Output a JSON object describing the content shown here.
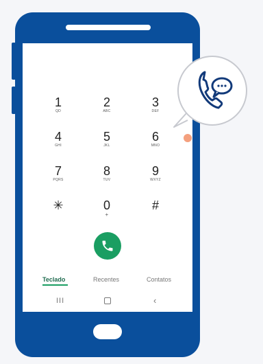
{
  "keypad": [
    {
      "num": "1",
      "sub": "QD"
    },
    {
      "num": "2",
      "sub": "ABC"
    },
    {
      "num": "3",
      "sub": "DEF"
    },
    {
      "num": "4",
      "sub": "GHI"
    },
    {
      "num": "5",
      "sub": "JKL"
    },
    {
      "num": "6",
      "sub": "MNO"
    },
    {
      "num": "7",
      "sub": "PQRS"
    },
    {
      "num": "8",
      "sub": "TUV"
    },
    {
      "num": "9",
      "sub": "WXYZ"
    },
    {
      "num": "✳",
      "sub": ""
    },
    {
      "num": "0",
      "sub": "+"
    },
    {
      "num": "#",
      "sub": ""
    }
  ],
  "tabs": {
    "teclado": "Teclado",
    "recentes": "Recentes",
    "contatos": "Contatos"
  },
  "icons": {
    "call": "phone-icon",
    "recents_nav": "recent-apps-icon",
    "home_nav": "home-icon",
    "back_nav": "back-icon",
    "bubble": "phone-chat-icon"
  },
  "colors": {
    "phone_body": "#0a4f9c",
    "call_button": "#1a9e62",
    "active_tab": "#1f6b4f"
  }
}
